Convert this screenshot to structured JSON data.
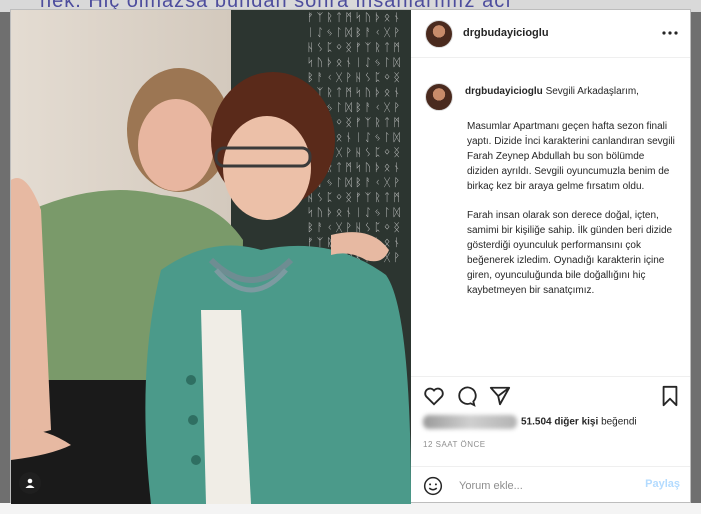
{
  "background": {
    "text": "nek. Hiç olmazsa bundan sonra insanlarımız acı"
  },
  "photo": {
    "wall_glyphs": "ᚠᛉᚱᛏᛗᛋᚢᚦᛟᚾᛁᛇᛃᛚᛞᛒᚨᚲᚷᚹᚺᛊᛈᛜᛝᚠᛉᚱᛏᛗᛋᚢᚦᛟᚾᛁᛇᛃᛚᛞᛒᚨᚲᚷᚹᚺᛊᛈᛜᛝᚠᛉᚱᛏᛗᛋᚢᚦᛟᚾᛁᛇᛃᛚᛞᛒᚨᚲᚷᚹᚺᛊᛈᛜᛝᚠᛉᚱᛏᛗᛋᚢᚦᛟᚾᛁᛇᛃᛚᛞᛒᚨᚲᚷᚹᚺᛊᛈᛜᛝᚠᛉᚱᛏᛗᛋᚢᚦᛟᚾᛁᛇᛃᛚᛞᛒᚨᚲᚷᚹᚺᛊᛈᛜᛝᚠᛉᚱᛏᛗᛋᚢᚦᛟᚾᛁᛇᛃᛚᛞᛒᚨᚲᚷᚹᚺᛊᛈᛜᛝᚠᛉᚱᛏᛗᛋᚢᚦᛟᚾᛁᛇᛃᛚᛞᛒᚨᚲᚷᚹᚺᛊᛈᛜᛝ"
  },
  "header": {
    "username": "drgbudayicioglu",
    "more_icon": "more-icon"
  },
  "caption": {
    "username": "drgbudayicioglu",
    "greeting": "Sevgili Arkadaşlarım,",
    "paragraph_1": "Masumlar Apartmanı geçen hafta sezon finali yaptı. Dizide İnci karakterini canlandıran sevgili Farah Zeynep Abdullah bu son bölümde diziden ayrıldı. Sevgili oyuncumuzla benim de birkaç kez bir araya gelme fırsatım oldu.",
    "paragraph_2": "Farah insan olarak son derece doğal, içten, samimi bir kişiliğe sahip. İlk günden beri dizide gösterdiği oyunculuk performansını çok beğenerek izledim. Oynadığı karakterin içine giren, oyunculuğunda bile doğallığını hiç kaybetmeyen bir sanatçımız."
  },
  "likes": {
    "count": "51.504 diğer kişi",
    "suffix": "beğendi"
  },
  "time": "12 SAAT ÖNCE",
  "comment": {
    "placeholder": "Yorum ekle...",
    "post_label": "Paylaş"
  },
  "colors": {
    "post_button": "#b3dbff",
    "text": "#262626",
    "muted": "#8e8e8e"
  }
}
